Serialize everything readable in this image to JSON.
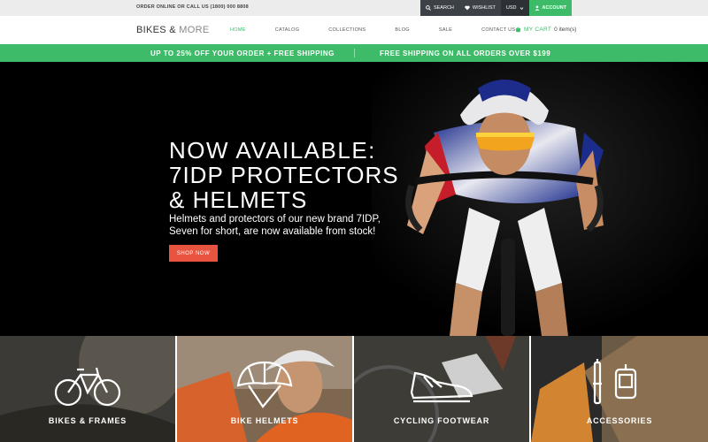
{
  "topbar": {
    "order_text": "ORDER ONLINE OR CALL US (1800) 000 8808",
    "search_label": "SEARCH",
    "wishlist_label": "WISHLIST",
    "currency": "USD",
    "account_label": "ACCOUNT"
  },
  "header": {
    "logo_main": "BIKES &",
    "logo_more": "MORE",
    "nav": [
      "HOME",
      "CATALOG",
      "COLLECTIONS",
      "BLOG",
      "SALE",
      "CONTACT US"
    ],
    "cart_label": "MY CART",
    "cart_count": "0 item(s)"
  },
  "promo": {
    "left": "UP TO 25% OFF YOUR ORDER + FREE SHIPPING",
    "right": "FREE SHIPPING ON ALL ORDERS OVER $199"
  },
  "hero": {
    "pre_title": "NOW AVAILABLE:",
    "title": "7IDP PROTECTORS & HELMETS",
    "text": "Helmets and protectors of our new brand 7IDP, Seven for short, are now available from stock!",
    "button": "SHOP NOW"
  },
  "categories": [
    {
      "label": "BIKES & FRAMES",
      "icon": "bike-icon"
    },
    {
      "label": "BIKE HELMETS",
      "icon": "helmet-icon"
    },
    {
      "label": "CYCLING FOOTWEAR",
      "icon": "shoe-icon"
    },
    {
      "label": "ACCESSORIES",
      "icon": "accessories-icon"
    }
  ],
  "colors": {
    "accent_green": "#3dbb69",
    "button_red": "#e8543f",
    "dark_topbar": "#3c4047"
  }
}
